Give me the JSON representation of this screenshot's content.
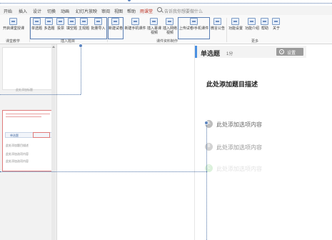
{
  "menu": {
    "tabs": [
      "开始",
      "插入",
      "设计",
      "切换",
      "动画",
      "幻灯片放映",
      "审阅",
      "视图",
      "帮助",
      "雨课堂"
    ],
    "active_tab": "雨课堂",
    "search_placeholder": "告诉我你想要做什么"
  },
  "ribbon": {
    "buttons": [
      "开启课堂授课",
      "单选题",
      "多选题",
      "投票",
      "填空题",
      "主观题",
      "批量导入",
      "新建试卷",
      "新建手机课件",
      "插入慕课视频",
      "插入网络视频",
      "上传试卷/手机课件",
      "微言公告",
      "功能设置",
      "功能介绍",
      "帮助",
      "关于"
    ],
    "groups": [
      "课堂教学",
      "插入题目",
      "课件资料制作",
      "更多"
    ]
  },
  "left_pane": {
    "thumb1_caption": "此处添加标题",
    "thumb2_caption": "此处添加选项内容",
    "thumb2_text": "此处添加题目描述"
  },
  "question_panel": {
    "type": "单选题",
    "score": "1分",
    "settings_label": "设置",
    "description": "此处添加题目描述",
    "options": [
      {
        "letter": "A",
        "text": "此处添加选项内容",
        "color": "#bdbdbd"
      },
      {
        "letter": "B",
        "text": "此处添加选项内容",
        "color": "#d2d2d2"
      },
      {
        "letter": "C",
        "text": "此处添加选项内容",
        "color": "#9bd89b"
      }
    ]
  },
  "colors": {
    "accent": "#4a90e2",
    "active_tab": "#c0392b",
    "selection": "#5b84bf"
  },
  "icons": [
    "search-icon",
    "gear-icon"
  ]
}
